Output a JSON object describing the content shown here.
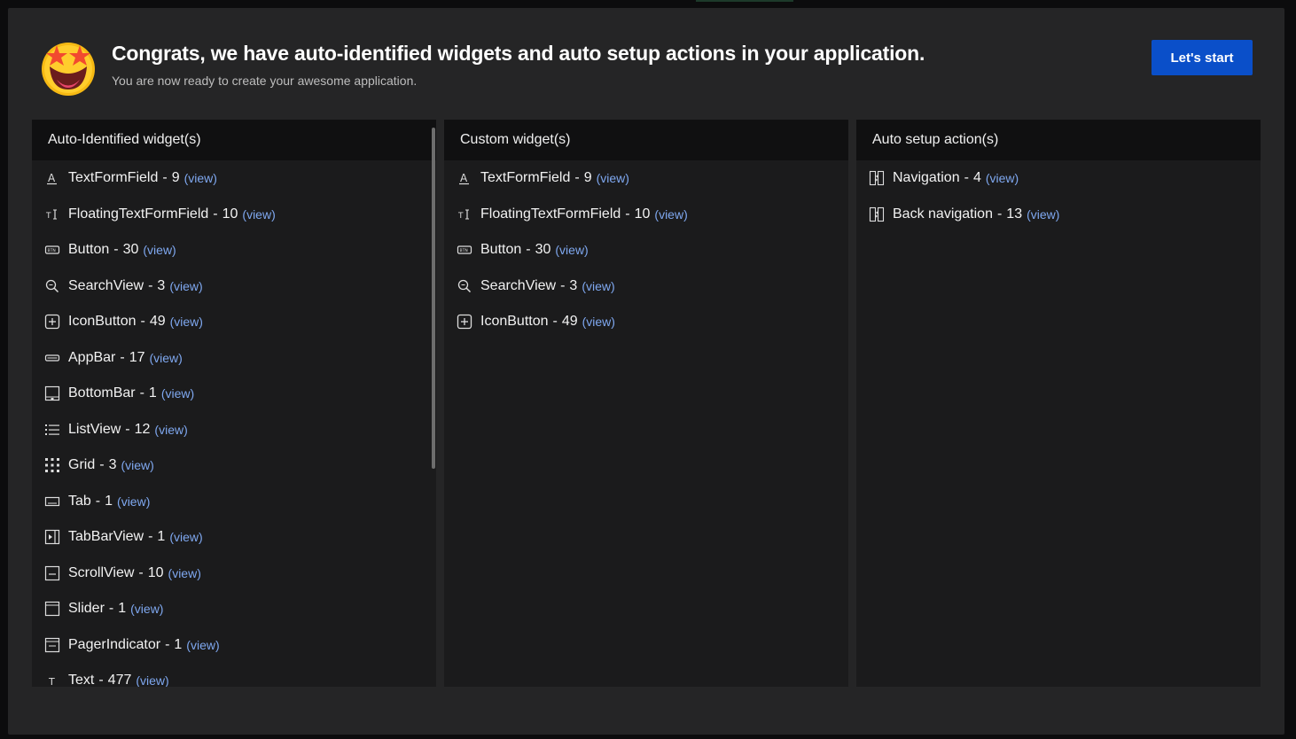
{
  "header": {
    "title": "Congrats, we have auto-identified widgets and auto setup actions in your application.",
    "subtitle": "You are now ready to create your awesome application.",
    "start_label": "Let's start"
  },
  "panels": [
    {
      "title": "Auto-Identified widget(s)",
      "items": [
        {
          "icon": "text-field-icon",
          "name": "TextFormField",
          "count": "9",
          "link": "(view)"
        },
        {
          "icon": "text-cursor-icon",
          "name": "FloatingTextFormField",
          "count": "10",
          "link": "(view)"
        },
        {
          "icon": "button-icon",
          "name": "Button",
          "count": "30",
          "link": "(view)"
        },
        {
          "icon": "search-icon",
          "name": "SearchView",
          "count": "3",
          "link": "(view)"
        },
        {
          "icon": "plus-square-icon",
          "name": "IconButton",
          "count": "49",
          "link": "(view)"
        },
        {
          "icon": "appbar-icon",
          "name": "AppBar",
          "count": "17",
          "link": "(view)"
        },
        {
          "icon": "bottombar-icon",
          "name": "BottomBar",
          "count": "1",
          "link": "(view)"
        },
        {
          "icon": "list-icon",
          "name": "ListView",
          "count": "12",
          "link": "(view)"
        },
        {
          "icon": "grid-icon",
          "name": "Grid",
          "count": "3",
          "link": "(view)"
        },
        {
          "icon": "tab-icon",
          "name": "Tab",
          "count": "1",
          "link": "(view)"
        },
        {
          "icon": "tabbar-icon",
          "name": "TabBarView",
          "count": "1",
          "link": "(view)"
        },
        {
          "icon": "scroll-icon",
          "name": "ScrollView",
          "count": "10",
          "link": "(view)"
        },
        {
          "icon": "slider-icon",
          "name": "Slider",
          "count": "1",
          "link": "(view)"
        },
        {
          "icon": "pager-icon",
          "name": "PagerIndicator",
          "count": "1",
          "link": "(view)"
        },
        {
          "icon": "text-icon",
          "name": "Text",
          "count": "477",
          "link": "(view)"
        }
      ]
    },
    {
      "title": "Custom widget(s)",
      "items": [
        {
          "icon": "text-field-icon",
          "name": "TextFormField",
          "count": "9",
          "link": "(view)"
        },
        {
          "icon": "text-cursor-icon",
          "name": "FloatingTextFormField",
          "count": "10",
          "link": "(view)"
        },
        {
          "icon": "button-icon",
          "name": "Button",
          "count": "30",
          "link": "(view)"
        },
        {
          "icon": "search-icon",
          "name": "SearchView",
          "count": "3",
          "link": "(view)"
        },
        {
          "icon": "plus-square-icon",
          "name": "IconButton",
          "count": "49",
          "link": "(view)"
        }
      ]
    },
    {
      "title": "Auto setup action(s)",
      "items": [
        {
          "icon": "navigation-icon",
          "name": "Navigation",
          "count": "4",
          "link": "(view)"
        },
        {
          "icon": "navigation-icon",
          "name": "Back navigation",
          "count": "13",
          "link": "(view)"
        }
      ]
    }
  ]
}
